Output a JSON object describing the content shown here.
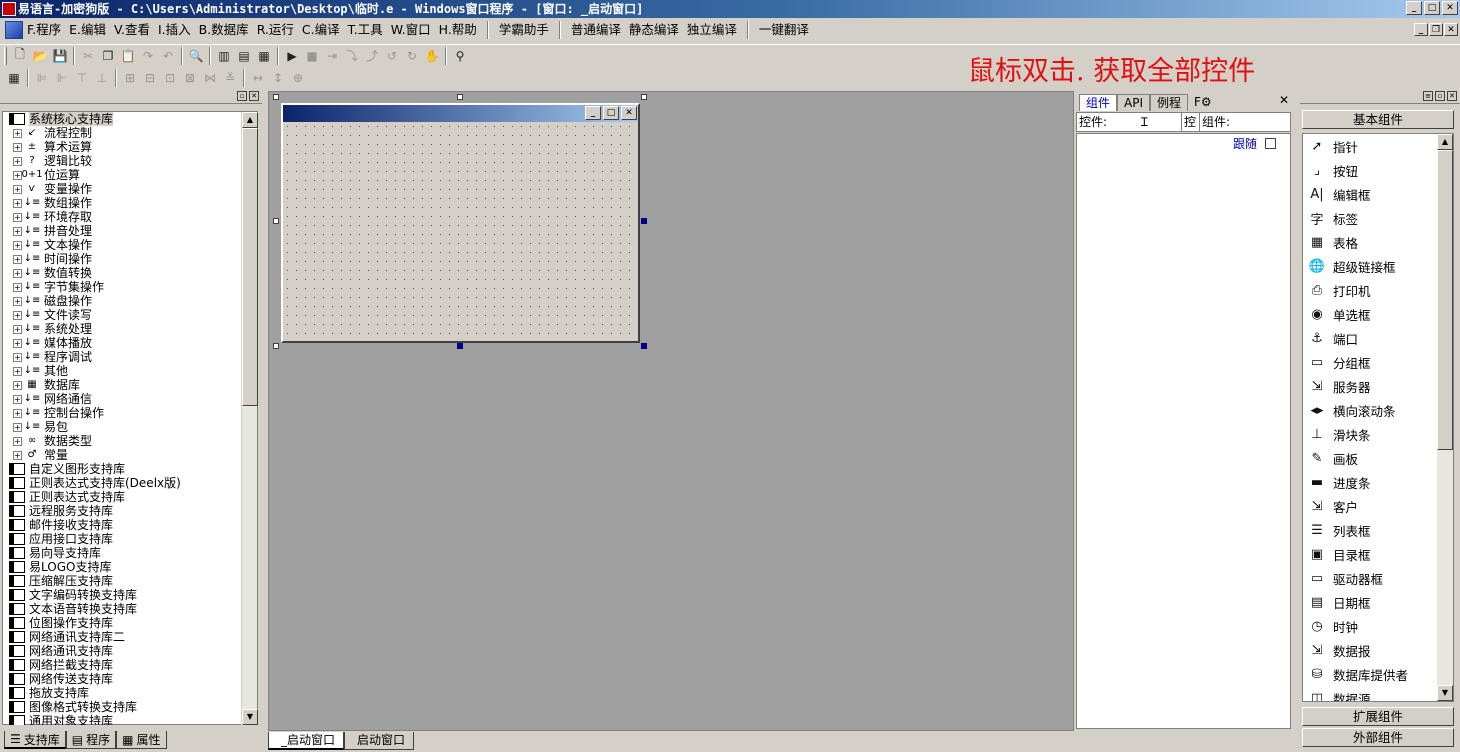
{
  "window": {
    "title": "易语言-加密狗版 - C:\\Users\\Administrator\\Desktop\\临时.e - Windows窗口程序 - [窗口: _启动窗口]"
  },
  "menu": [
    "F.程序",
    "E.编辑",
    "V.查看",
    "I.插入",
    "B.数据库",
    "R.运行",
    "C.编译",
    "T.工具",
    "W.窗口",
    "H.帮助",
    "学霸助手",
    "普通编译",
    "静态编译",
    "独立编译",
    "一键翻译"
  ],
  "hint_text": "鼠标双击. 获取全部控件",
  "left_panel": {
    "tree": [
      {
        "label": "系统核心支持库",
        "kind": "root",
        "icon": "book-icon",
        "selected": true
      },
      {
        "label": "流程控制",
        "kind": "child",
        "icon": "arrow-icon",
        "glyph": "↙"
      },
      {
        "label": "算术运算",
        "kind": "child",
        "icon": "math-icon",
        "glyph": "±"
      },
      {
        "label": "逻辑比较",
        "kind": "child",
        "icon": "question-icon",
        "glyph": "?"
      },
      {
        "label": "位运算",
        "kind": "child",
        "icon": "bit-icon",
        "glyph": "0+1"
      },
      {
        "label": "变量操作",
        "kind": "child",
        "icon": "variable-icon",
        "glyph": "ѵ"
      },
      {
        "label": "数组操作",
        "kind": "child",
        "icon": "command-icon",
        "glyph": "↓≡"
      },
      {
        "label": "环境存取",
        "kind": "child",
        "icon": "command-icon",
        "glyph": "↓≡"
      },
      {
        "label": "拼音处理",
        "kind": "child",
        "icon": "command-icon",
        "glyph": "↓≡"
      },
      {
        "label": "文本操作",
        "kind": "child",
        "icon": "command-icon",
        "glyph": "↓≡"
      },
      {
        "label": "时间操作",
        "kind": "child",
        "icon": "command-icon",
        "glyph": "↓≡"
      },
      {
        "label": "数值转换",
        "kind": "child",
        "icon": "command-icon",
        "glyph": "↓≡"
      },
      {
        "label": "字节集操作",
        "kind": "child",
        "icon": "command-icon",
        "glyph": "↓≡"
      },
      {
        "label": "磁盘操作",
        "kind": "child",
        "icon": "command-icon",
        "glyph": "↓≡"
      },
      {
        "label": "文件读写",
        "kind": "child",
        "icon": "command-icon",
        "glyph": "↓≡"
      },
      {
        "label": "系统处理",
        "kind": "child",
        "icon": "command-icon",
        "glyph": "↓≡"
      },
      {
        "label": "媒体播放",
        "kind": "child",
        "icon": "command-icon",
        "glyph": "↓≡"
      },
      {
        "label": "程序调试",
        "kind": "child",
        "icon": "command-icon",
        "glyph": "↓≡"
      },
      {
        "label": "其他",
        "kind": "child",
        "icon": "command-icon",
        "glyph": "↓≡"
      },
      {
        "label": "数据库",
        "kind": "child",
        "icon": "grid-icon",
        "glyph": "▦"
      },
      {
        "label": "网络通信",
        "kind": "child",
        "icon": "command-icon",
        "glyph": "↓≡"
      },
      {
        "label": "控制台操作",
        "kind": "child",
        "icon": "command-icon",
        "glyph": "↓≡"
      },
      {
        "label": "易包",
        "kind": "child",
        "icon": "command-icon",
        "glyph": "↓≡"
      },
      {
        "label": "数据类型",
        "kind": "child",
        "icon": "datatype-icon",
        "glyph": "∞"
      },
      {
        "label": "常量",
        "kind": "child",
        "icon": "constant-icon",
        "glyph": "♂"
      },
      {
        "label": "自定义图形支持库",
        "kind": "root",
        "icon": "book-icon"
      },
      {
        "label": "正则表达式支持库(Deelx版)",
        "kind": "root",
        "icon": "book-icon"
      },
      {
        "label": "正则表达式支持库",
        "kind": "root",
        "icon": "book-icon"
      },
      {
        "label": "远程服务支持库",
        "kind": "root",
        "icon": "book-icon"
      },
      {
        "label": "邮件接收支持库",
        "kind": "root",
        "icon": "book-icon"
      },
      {
        "label": "应用接口支持库",
        "kind": "root",
        "icon": "book-icon"
      },
      {
        "label": "易向导支持库",
        "kind": "root",
        "icon": "book-icon"
      },
      {
        "label": "易LOGO支持库",
        "kind": "root",
        "icon": "book-icon"
      },
      {
        "label": "压缩解压支持库",
        "kind": "root",
        "icon": "book-icon"
      },
      {
        "label": "文字编码转换支持库",
        "kind": "root",
        "icon": "book-icon"
      },
      {
        "label": "文本语音转换支持库",
        "kind": "root",
        "icon": "book-icon"
      },
      {
        "label": "位图操作支持库",
        "kind": "root",
        "icon": "book-icon"
      },
      {
        "label": "网络通讯支持库二",
        "kind": "root",
        "icon": "book-icon"
      },
      {
        "label": "网络通讯支持库",
        "kind": "root",
        "icon": "book-icon"
      },
      {
        "label": "网络拦截支持库",
        "kind": "root",
        "icon": "book-icon"
      },
      {
        "label": "网络传送支持库",
        "kind": "root",
        "icon": "book-icon"
      },
      {
        "label": "拖放支持库",
        "kind": "root",
        "icon": "book-icon"
      },
      {
        "label": "图像格式转换支持库",
        "kind": "root",
        "icon": "book-icon"
      },
      {
        "label": "通用对象支持库",
        "kind": "root",
        "icon": "book-icon"
      }
    ],
    "tabs": [
      "支持库",
      "程序",
      "属性"
    ]
  },
  "center": {
    "tabs": [
      "_启动窗口",
      "启动窗口"
    ]
  },
  "finder": {
    "tabs": [
      "组件",
      "API",
      "例程"
    ],
    "search_label_left": "控件:",
    "search_label_mid": "控",
    "search_label_right": "组件:",
    "follow_label": "跟随"
  },
  "toolbox": {
    "header": "基本组件",
    "items": [
      {
        "label": "指针",
        "icon": "pointer-icon",
        "glyph": "➚"
      },
      {
        "label": "按钮",
        "icon": "button-icon",
        "glyph": "⌟"
      },
      {
        "label": "编辑框",
        "icon": "editbox-icon",
        "glyph": "A|"
      },
      {
        "label": "标签",
        "icon": "label-icon",
        "glyph": "字"
      },
      {
        "label": "表格",
        "icon": "table-icon",
        "glyph": "▦"
      },
      {
        "label": "超级链接框",
        "icon": "hyperlink-icon",
        "glyph": "🌐"
      },
      {
        "label": "打印机",
        "icon": "printer-icon",
        "glyph": "⎙"
      },
      {
        "label": "单选框",
        "icon": "radio-icon",
        "glyph": "◉"
      },
      {
        "label": "端口",
        "icon": "port-icon",
        "glyph": "⚓"
      },
      {
        "label": "分组框",
        "icon": "groupbox-icon",
        "glyph": "▭"
      },
      {
        "label": "服务器",
        "icon": "server-icon",
        "glyph": "⇲"
      },
      {
        "label": "横向滚动条",
        "icon": "hscroll-icon",
        "glyph": "◂▸"
      },
      {
        "label": "滑块条",
        "icon": "slider-icon",
        "glyph": "⊥"
      },
      {
        "label": "画板",
        "icon": "canvas-icon",
        "glyph": "✎"
      },
      {
        "label": "进度条",
        "icon": "progress-icon",
        "glyph": "▬"
      },
      {
        "label": "客户",
        "icon": "client-icon",
        "glyph": "⇲"
      },
      {
        "label": "列表框",
        "icon": "listbox-icon",
        "glyph": "☰"
      },
      {
        "label": "目录框",
        "icon": "dirbox-icon",
        "glyph": "▣"
      },
      {
        "label": "驱动器框",
        "icon": "drivebox-icon",
        "glyph": "▭"
      },
      {
        "label": "日期框",
        "icon": "datebox-icon",
        "glyph": "▤"
      },
      {
        "label": "时钟",
        "icon": "clock-icon",
        "glyph": "◷"
      },
      {
        "label": "数据报",
        "icon": "datagram-icon",
        "glyph": "⇲"
      },
      {
        "label": "数据库提供者",
        "icon": "dbprovider-icon",
        "glyph": "⛁"
      },
      {
        "label": "数据源",
        "icon": "datasource-icon",
        "glyph": "◫"
      }
    ],
    "groups": [
      "扩展组件",
      "外部组件"
    ]
  }
}
